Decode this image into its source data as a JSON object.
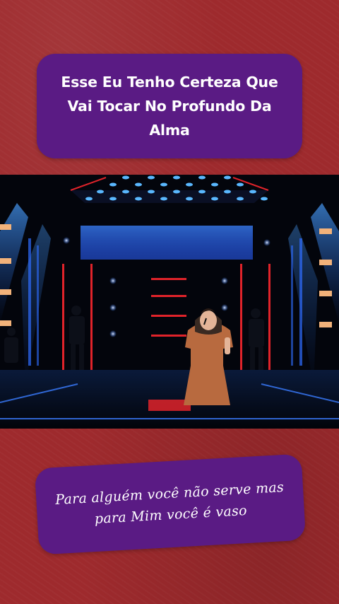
{
  "colors": {
    "background": "#9e2a2d",
    "caption_box": "#5a1b84",
    "caption_text": "#ffffff",
    "stage_blue": "#1f5fe0",
    "stage_red": "#e0232a",
    "dress": "#b86a3f"
  },
  "top_caption": {
    "text": "Esse Eu Tenho Certeza Que Vai Tocar No Profundo Da Alma"
  },
  "video": {
    "content": "singer-on-stage"
  },
  "bottom_caption": {
    "text": "Para alguém você não serve mas para Mim você é vaso"
  }
}
